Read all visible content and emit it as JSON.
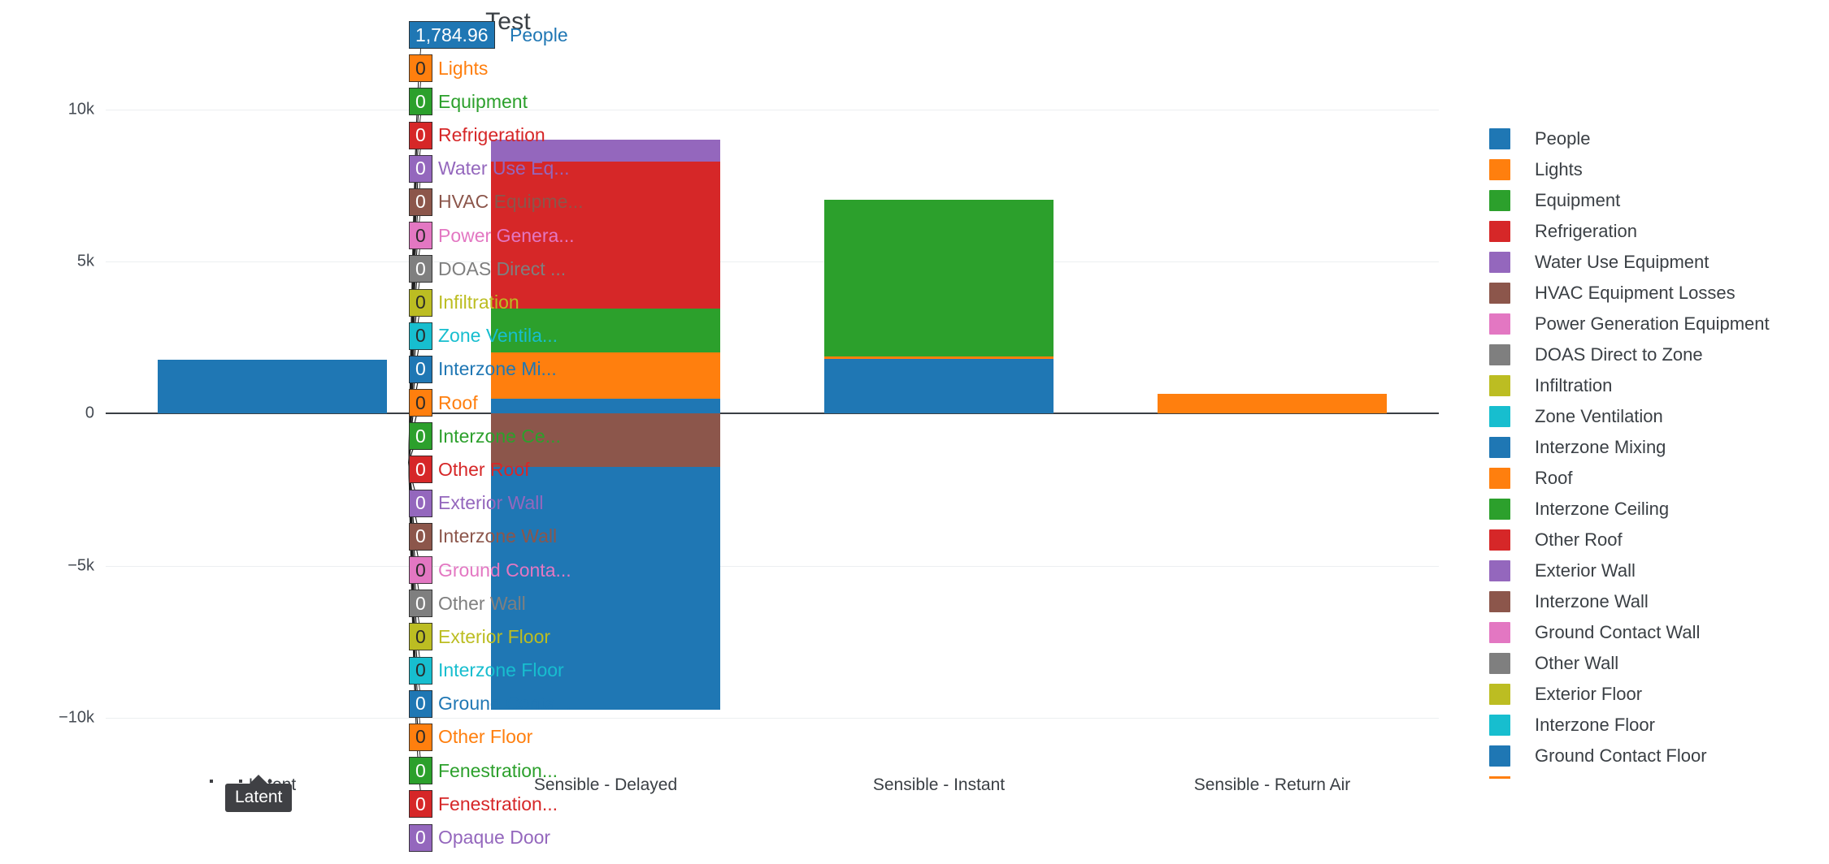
{
  "title": "Test",
  "axis": {
    "y_ticks": [
      "10k",
      "5k",
      "0",
      "−5k",
      "−10k"
    ],
    "y_values": [
      10000,
      5000,
      0,
      -5000,
      -10000
    ],
    "x_ticks": [
      "Latent",
      "Sensible - Delayed",
      "Sensible - Instant",
      "Sensible - Return Air"
    ]
  },
  "hover_tooltip": {
    "axis_label": "Latent",
    "rows": [
      {
        "value": "1,784.96",
        "name": "People",
        "color": "#1f77b4",
        "dark": false
      },
      {
        "value": "0",
        "name": "Lights",
        "color": "#ff7f0e",
        "dark": true
      },
      {
        "value": "0",
        "name": "Equipment",
        "color": "#2ca02c",
        "dark": false
      },
      {
        "value": "0",
        "name": "Refrigeration",
        "color": "#d62728",
        "dark": false
      },
      {
        "value": "0",
        "name": "Water Use Eq...",
        "color": "#9467bd",
        "dark": false
      },
      {
        "value": "0",
        "name": "HVAC Equipme...",
        "color": "#8c564b",
        "dark": false
      },
      {
        "value": "0",
        "name": "Power Genera...",
        "color": "#e377c2",
        "dark": true
      },
      {
        "value": "0",
        "name": "DOAS Direct ...",
        "color": "#7f7f7f",
        "dark": false
      },
      {
        "value": "0",
        "name": "Infiltration",
        "color": "#bcbd22",
        "dark": true
      },
      {
        "value": "0",
        "name": "Zone Ventila...",
        "color": "#17becf",
        "dark": true
      },
      {
        "value": "0",
        "name": "Interzone Mi...",
        "color": "#1f77b4",
        "dark": false
      },
      {
        "value": "0",
        "name": "Roof",
        "color": "#ff7f0e",
        "dark": true
      },
      {
        "value": "0",
        "name": "Interzone Ce...",
        "color": "#2ca02c",
        "dark": false
      },
      {
        "value": "0",
        "name": "Other Roof",
        "color": "#d62728",
        "dark": false
      },
      {
        "value": "0",
        "name": "Exterior Wall",
        "color": "#9467bd",
        "dark": false
      },
      {
        "value": "0",
        "name": "Interzone Wall",
        "color": "#8c564b",
        "dark": false
      },
      {
        "value": "0",
        "name": "Ground Conta...",
        "color": "#e377c2",
        "dark": true
      },
      {
        "value": "0",
        "name": "Other Wall",
        "color": "#7f7f7f",
        "dark": false
      },
      {
        "value": "0",
        "name": "Exterior Floor",
        "color": "#bcbd22",
        "dark": true
      },
      {
        "value": "0",
        "name": "Interzone Floor",
        "color": "#17becf",
        "dark": true
      },
      {
        "value": "0",
        "name": "Ground Conta...",
        "color": "#1f77b4",
        "dark": false
      },
      {
        "value": "0",
        "name": "Other Floor",
        "color": "#ff7f0e",
        "dark": true
      },
      {
        "value": "0",
        "name": "Fenestration...",
        "color": "#2ca02c",
        "dark": false
      },
      {
        "value": "0",
        "name": "Fenestration...",
        "color": "#d62728",
        "dark": false
      },
      {
        "value": "0",
        "name": "Opaque Door",
        "color": "#9467bd",
        "dark": false
      }
    ]
  },
  "legend": {
    "items": [
      {
        "label": "People",
        "color": "#1f77b4"
      },
      {
        "label": "Lights",
        "color": "#ff7f0e"
      },
      {
        "label": "Equipment",
        "color": "#2ca02c"
      },
      {
        "label": "Refrigeration",
        "color": "#d62728"
      },
      {
        "label": "Water Use Equipment",
        "color": "#9467bd"
      },
      {
        "label": "HVAC Equipment Losses",
        "color": "#8c564b"
      },
      {
        "label": "Power Generation Equipment",
        "color": "#e377c2"
      },
      {
        "label": "DOAS Direct to Zone",
        "color": "#7f7f7f"
      },
      {
        "label": "Infiltration",
        "color": "#bcbd22"
      },
      {
        "label": "Zone Ventilation",
        "color": "#17becf"
      },
      {
        "label": "Interzone Mixing",
        "color": "#1f77b4"
      },
      {
        "label": "Roof",
        "color": "#ff7f0e"
      },
      {
        "label": "Interzone Ceiling",
        "color": "#2ca02c"
      },
      {
        "label": "Other Roof",
        "color": "#d62728"
      },
      {
        "label": "Exterior Wall",
        "color": "#9467bd"
      },
      {
        "label": "Interzone Wall",
        "color": "#8c564b"
      },
      {
        "label": "Ground Contact Wall",
        "color": "#e377c2"
      },
      {
        "label": "Other Wall",
        "color": "#7f7f7f"
      },
      {
        "label": "Exterior Floor",
        "color": "#bcbd22"
      },
      {
        "label": "Interzone Floor",
        "color": "#17becf"
      },
      {
        "label": "Ground Contact Floor",
        "color": "#1f77b4"
      }
    ]
  },
  "chart_data": {
    "type": "bar",
    "title": "Test",
    "xlabel": "",
    "ylabel": "",
    "ylim": [
      -11500,
      12000
    ],
    "grid": true,
    "legend_position": "right",
    "stacked": true,
    "categories": [
      "Latent",
      "Sensible - Delayed",
      "Sensible - Instant",
      "Sensible - Return Air"
    ],
    "series": [
      {
        "name": "People",
        "color": "#1f77b4",
        "values": [
          1784.96,
          500,
          1800,
          0
        ]
      },
      {
        "name": "Lights",
        "color": "#ff7f0e",
        "values": [
          0,
          1500,
          80,
          650
        ]
      },
      {
        "name": "Equipment",
        "color": "#2ca02c",
        "values": [
          0,
          1450,
          5150,
          0
        ]
      },
      {
        "name": "Refrigeration",
        "color": "#d62728",
        "values": [
          0,
          4850,
          0,
          0
        ]
      },
      {
        "name": "Water Use Equipment",
        "color": "#9467bd",
        "values": [
          0,
          0,
          0,
          0
        ]
      },
      {
        "name": "HVAC Equipment Losses",
        "color": "#8c564b",
        "values": [
          0,
          -1750,
          0,
          0
        ]
      },
      {
        "name": "Power Generation Equipment",
        "color": "#e377c2",
        "values": [
          0,
          0,
          0,
          0
        ]
      },
      {
        "name": "DOAS Direct to Zone",
        "color": "#7f7f7f",
        "values": [
          0,
          0,
          0,
          0
        ]
      },
      {
        "name": "Infiltration",
        "color": "#bcbd22",
        "values": [
          0,
          0,
          0,
          0
        ]
      },
      {
        "name": "Zone Ventilation",
        "color": "#17becf",
        "values": [
          0,
          0,
          0,
          0
        ]
      },
      {
        "name": "Interzone Mixing",
        "color": "#1f77b4",
        "values": [
          0,
          0,
          0,
          0
        ]
      },
      {
        "name": "Roof",
        "color": "#ff7f0e",
        "values": [
          0,
          0,
          0,
          0
        ]
      },
      {
        "name": "Interzone Ceiling",
        "color": "#2ca02c",
        "values": [
          0,
          0,
          0,
          0
        ]
      },
      {
        "name": "Other Roof",
        "color": "#d62728",
        "values": [
          0,
          0,
          0,
          0
        ]
      },
      {
        "name": "Exterior Wall",
        "color": "#9467bd",
        "values": [
          0,
          700,
          0,
          0
        ]
      },
      {
        "name": "Interzone Wall",
        "color": "#8c564b",
        "values": [
          0,
          0,
          0,
          0
        ]
      },
      {
        "name": "Ground Contact Wall",
        "color": "#e377c2",
        "values": [
          0,
          0,
          0,
          0
        ]
      },
      {
        "name": "Other Wall",
        "color": "#7f7f7f",
        "values": [
          0,
          0,
          0,
          0
        ]
      },
      {
        "name": "Exterior Floor",
        "color": "#bcbd22",
        "values": [
          0,
          0,
          0,
          0
        ]
      },
      {
        "name": "Interzone Floor",
        "color": "#17becf",
        "values": [
          0,
          0,
          0,
          0
        ]
      },
      {
        "name": "Ground Contact Floor",
        "color": "#1f77b4",
        "values": [
          0,
          -8000,
          0,
          0
        ]
      }
    ],
    "hovered_category": "Latent",
    "hovered_values": {
      "People": 1784.96,
      "Lights": 0,
      "Equipment": 0,
      "Refrigeration": 0,
      "Water Use Equipment": 0,
      "HVAC Equipment Losses": 0,
      "Power Generation Equipment": 0,
      "DOAS Direct to Zone": 0,
      "Infiltration": 0,
      "Zone Ventilation": 0,
      "Interzone Mixing": 0,
      "Roof": 0,
      "Interzone Ceiling": 0,
      "Other Roof": 0,
      "Exterior Wall": 0,
      "Interzone Wall": 0,
      "Ground Contact Wall": 0,
      "Other Wall": 0,
      "Exterior Floor": 0,
      "Interzone Floor": 0,
      "Ground Contact Floor": 0,
      "Other Floor": 0,
      "Fenestration (1)": 0,
      "Fenestration (2)": 0,
      "Opaque Door": 0
    }
  }
}
